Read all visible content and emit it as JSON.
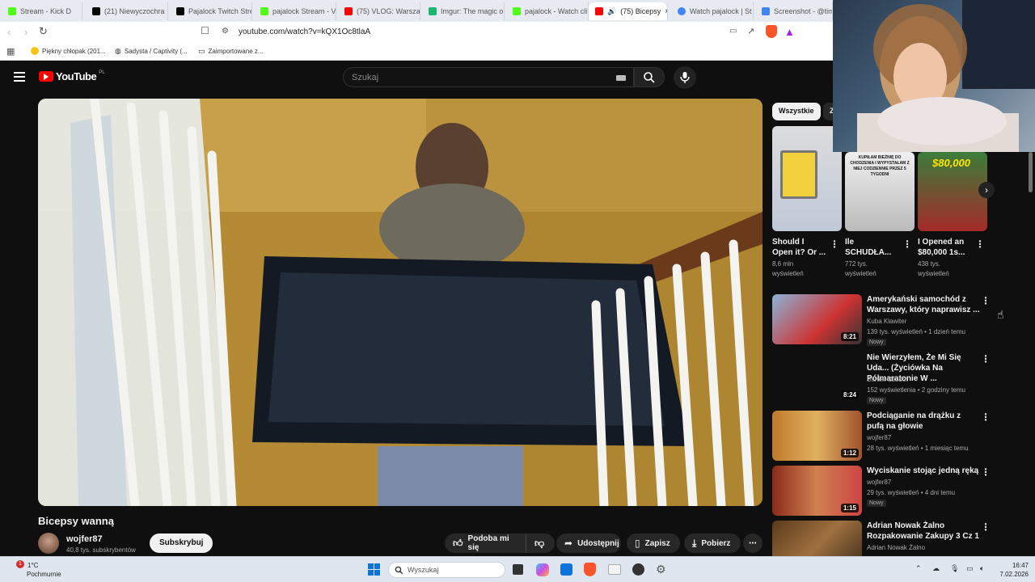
{
  "browser": {
    "tabs": [
      {
        "label": "Stream - Kick D",
        "color": "#53fc18"
      },
      {
        "label": "(21) Niewyczochra",
        "color": "#000000"
      },
      {
        "label": "Pajalock Twitch Stre",
        "color": "#000000"
      },
      {
        "label": "pajalock Stream - V",
        "color": "#53fc18"
      },
      {
        "label": "(75) VLOG: Warsza",
        "color": "#ff0000"
      },
      {
        "label": "Imgur: The magic o",
        "color": "#1bb76e"
      },
      {
        "label": "pajalock - Watch cli",
        "color": "#53fc18"
      },
      {
        "label": "(75) Bicepsy",
        "color": "#ff0000"
      },
      {
        "label": "Watch pajalock | St",
        "color": "#4285f4"
      },
      {
        "label": "Screenshot - @tim",
        "color": "#4285f4"
      }
    ],
    "url": "youtube.com/watch?v=kQX1Oc8tlaA",
    "bookmarks": [
      "Piękny chłopak (201...",
      "Sadysta / Captivity (...",
      "Zaimportowane z..."
    ]
  },
  "youtube": {
    "logo": "YouTube",
    "region": "PL",
    "search_placeholder": "Szukaj",
    "video_title": "Bicepsy wanną",
    "channel": "wojfer87",
    "subscribers": "40,8 tys. subskrybentów",
    "subscribe_label": "Subskrybuj",
    "actions": {
      "like": "Podoba mi się",
      "share": "Udostępnij",
      "save": "Zapisz",
      "download": "Pobierz"
    },
    "chips": [
      "Wszystkie",
      "Z"
    ],
    "shorts": [
      {
        "title1": "Should I",
        "title2": "Open it? Or ...",
        "views": "8,6 mln",
        "views2": "wyświetleń"
      },
      {
        "title1": "Ile",
        "title2": "SCHUDŁA...",
        "views": "772 tys.",
        "views2": "wyświetleń",
        "overlay": "KUPIŁAM BIEŻNIĘ DO CHODZENIA I WYPYSTAŁAM Z NIEJ CODZIENNIE PRZEZ 5 TYGODNI"
      },
      {
        "title1": "I Opened an",
        "title2": "$80,000 1s...",
        "views": "438 tys.",
        "views2": "wyświetleń",
        "overlay": "$80,000"
      }
    ],
    "recommended": [
      {
        "title": "Amerykański samochód z Warszawy, który naprawisz ...",
        "channel": "Kuba Klawiter",
        "meta": "139 tys. wyświetleń • 1 dzień temu",
        "badge": "Nowy",
        "duration": "8:21"
      },
      {
        "title": "Nie Wierzyłem, Że Mi Się Uda... (Życiówka Na Półmaratonie W ...",
        "channel": "Bartek Czobot",
        "meta": "152 wyświetlenia • 2 godziny temu",
        "badge": "Nowy",
        "duration": "8:24"
      },
      {
        "title": "Podciąganie na drążku z pufą na głowie",
        "channel": "wojfer87",
        "meta": "28 tys. wyświetleń • 1 miesiąc temu",
        "badge": "",
        "duration": "1:12"
      },
      {
        "title": "Wyciskanie stojąc jedną ręką",
        "channel": "wojfer87",
        "meta": "29 tys. wyświetleń • 4 dni temu",
        "badge": "Nowy",
        "duration": "1:15"
      },
      {
        "title": "Adrian Nowak Żalno Rozpakowanie Zakupy 3 Cz 1",
        "channel": "Adrian Nowak Żalno",
        "meta": "",
        "badge": "",
        "duration": ""
      }
    ]
  },
  "taskbar": {
    "weather_temp": "1°C",
    "weather_desc": "Pochmurnie",
    "search_placeholder": "Wyszukaj",
    "time": "16:47",
    "date": "7.02.2026"
  }
}
